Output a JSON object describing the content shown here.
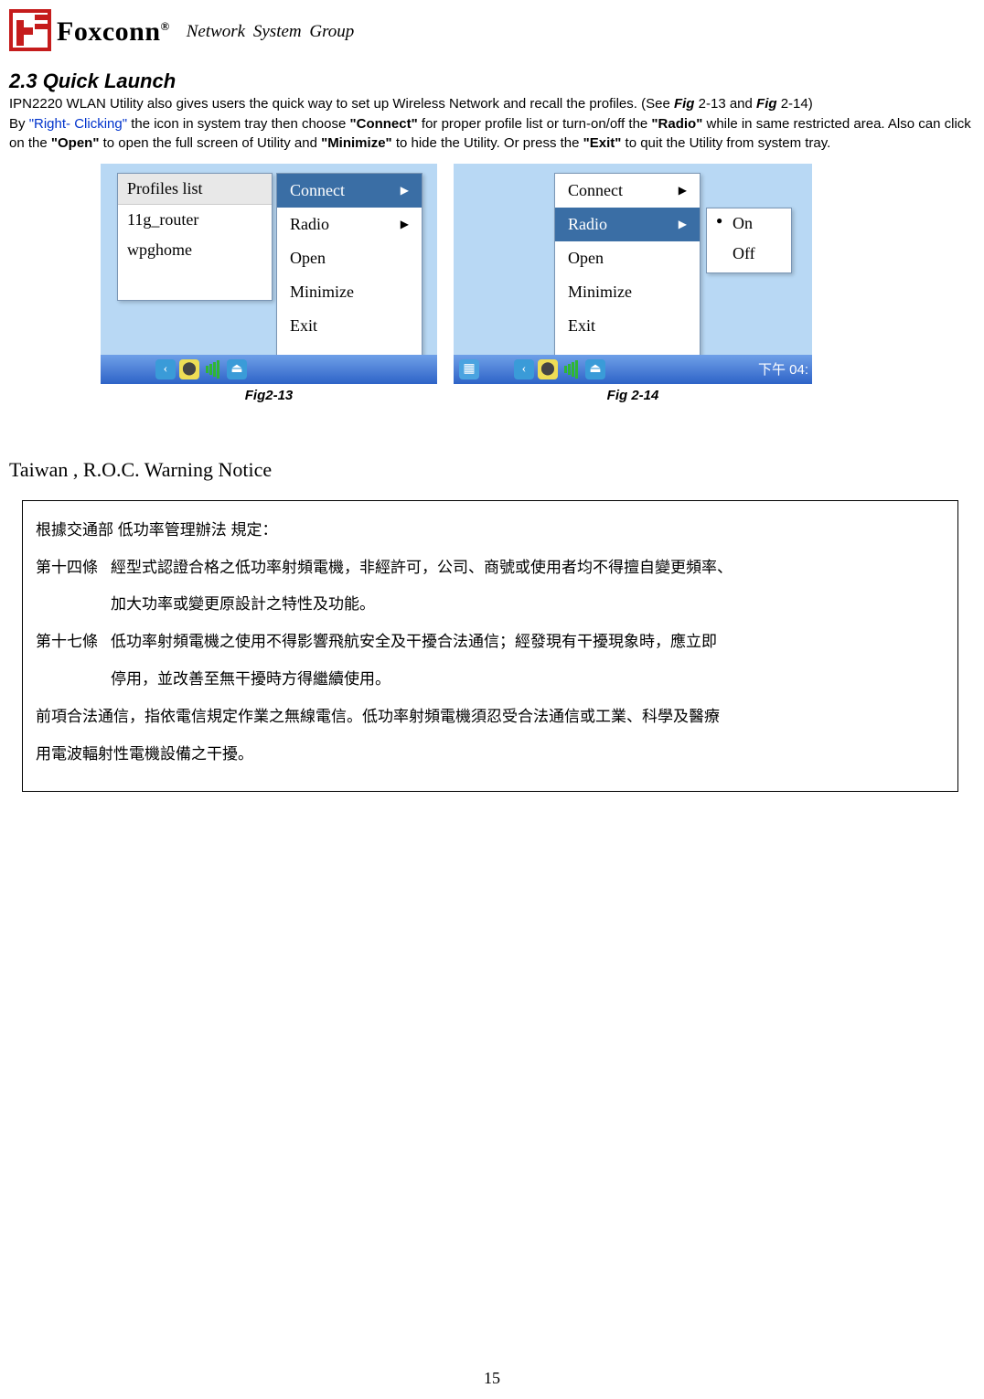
{
  "logo": {
    "brand": "Foxconn",
    "reg": "®",
    "subtitle": "Network  System  Group"
  },
  "section": {
    "title": "2.3 Quick Launch",
    "para1_a": "IPN2220 WLAN Utility also gives users the quick way to set up Wireless Network and recall the profiles. (See ",
    "para1_figA": "Fig",
    "para1_b": " 2-13 and ",
    "para1_figB": "Fig",
    "para1_c": " 2-14)",
    "para2_a": "By ",
    "para2_right": "\"Right- Clicking\"",
    "para2_b": " the icon in system tray then choose ",
    "para2_connect": "\"Connect\"",
    "para2_c": " for proper profile list or turn-on/off the ",
    "para2_radio": "\"Radio\"",
    "para2_d": " while in same restricted area. Also can click on the ",
    "para2_open": "\"Open\"",
    "para2_e": " to open the full screen of Utility and ",
    "para2_min": "\"Minimize\"",
    "para2_f": " to hide the Utility. Or press the ",
    "para2_exit": "\"Exit\"",
    "para2_g": " to quit the Utility from system tray."
  },
  "fig213": {
    "profiles_header": "Profiles list",
    "profiles": [
      "11g_router",
      "wpghome"
    ],
    "menu": {
      "connect": "Connect",
      "radio": "Radio",
      "open": "Open",
      "minimize": "Minimize",
      "exit": "Exit"
    },
    "caption": "Fig2-13"
  },
  "fig214": {
    "menu": {
      "connect": "Connect",
      "radio": "Radio",
      "open": "Open",
      "minimize": "Minimize",
      "exit": "Exit"
    },
    "radio_options": {
      "on": "On",
      "off": "Off"
    },
    "taskbar_time": "下午 04:",
    "caption": "Fig 2-14"
  },
  "notice": {
    "heading": "Taiwan , R.O.C. Warning Notice",
    "line1": "根據交通部 低功率管理辦法 規定：",
    "art14_label": "第十四條",
    "art14_text1": "經型式認證合格之低功率射頻電機，非經許可，公司、商號或使用者均不得擅自變更頻率、",
    "art14_text2": "加大功率或變更原設計之特性及功能。",
    "art17_label": "第十七條",
    "art17_text1": "低功率射頻電機之使用不得影響飛航安全及干擾合法通信；經發現有干擾現象時，應立即",
    "art17_text2": "停用，並改善至無干擾時方得繼續使用。",
    "tail1": "前項合法通信，指依電信規定作業之無線電信。低功率射頻電機須忍受合法通信或工業、科學及醫療",
    "tail2": "用電波輻射性電機設備之干擾。"
  },
  "page_number": "15"
}
